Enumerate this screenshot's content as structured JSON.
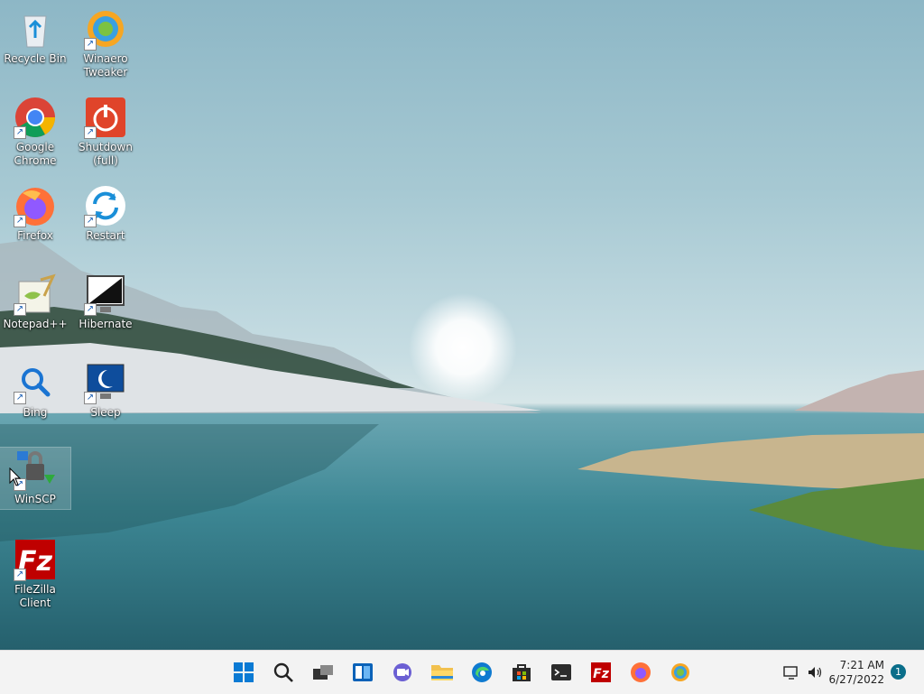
{
  "desktop": {
    "icons": [
      {
        "label": "Recycle Bin",
        "icon": "recycle-bin-icon"
      },
      {
        "label": "Winaero\nTweaker",
        "icon": "winaero-tweaker-icon"
      },
      {
        "label": "Google\nChrome",
        "icon": "chrome-icon"
      },
      {
        "label": "Shutdown\n(full)",
        "icon": "shutdown-icon"
      },
      {
        "label": "Firefox",
        "icon": "firefox-icon"
      },
      {
        "label": "Restart",
        "icon": "restart-icon"
      },
      {
        "label": "Notepad++",
        "icon": "notepad-plus-plus-icon"
      },
      {
        "label": "Hibernate",
        "icon": "hibernate-icon"
      },
      {
        "label": "Bing",
        "icon": "bing-search-icon"
      },
      {
        "label": "Sleep",
        "icon": "sleep-icon"
      },
      {
        "label": "WinSCP",
        "icon": "winscp-icon"
      },
      {
        "label": "FileZilla Client",
        "icon": "filezilla-icon"
      }
    ]
  },
  "taskbar": {
    "apps": [
      "start-icon",
      "search-icon",
      "task-view-icon",
      "widgets-icon",
      "chat-icon",
      "file-explorer-icon",
      "edge-icon",
      "store-icon",
      "terminal-icon",
      "filezilla-icon",
      "firefox-icon",
      "winaero-icon"
    ],
    "clock": {
      "time": "7:21 AM",
      "date": "6/27/2022"
    },
    "notifications": "1"
  },
  "colors": {
    "taskbar": "#f3f3f3",
    "accent": "#0078d4",
    "notif_badge": "#0a6e8a"
  }
}
